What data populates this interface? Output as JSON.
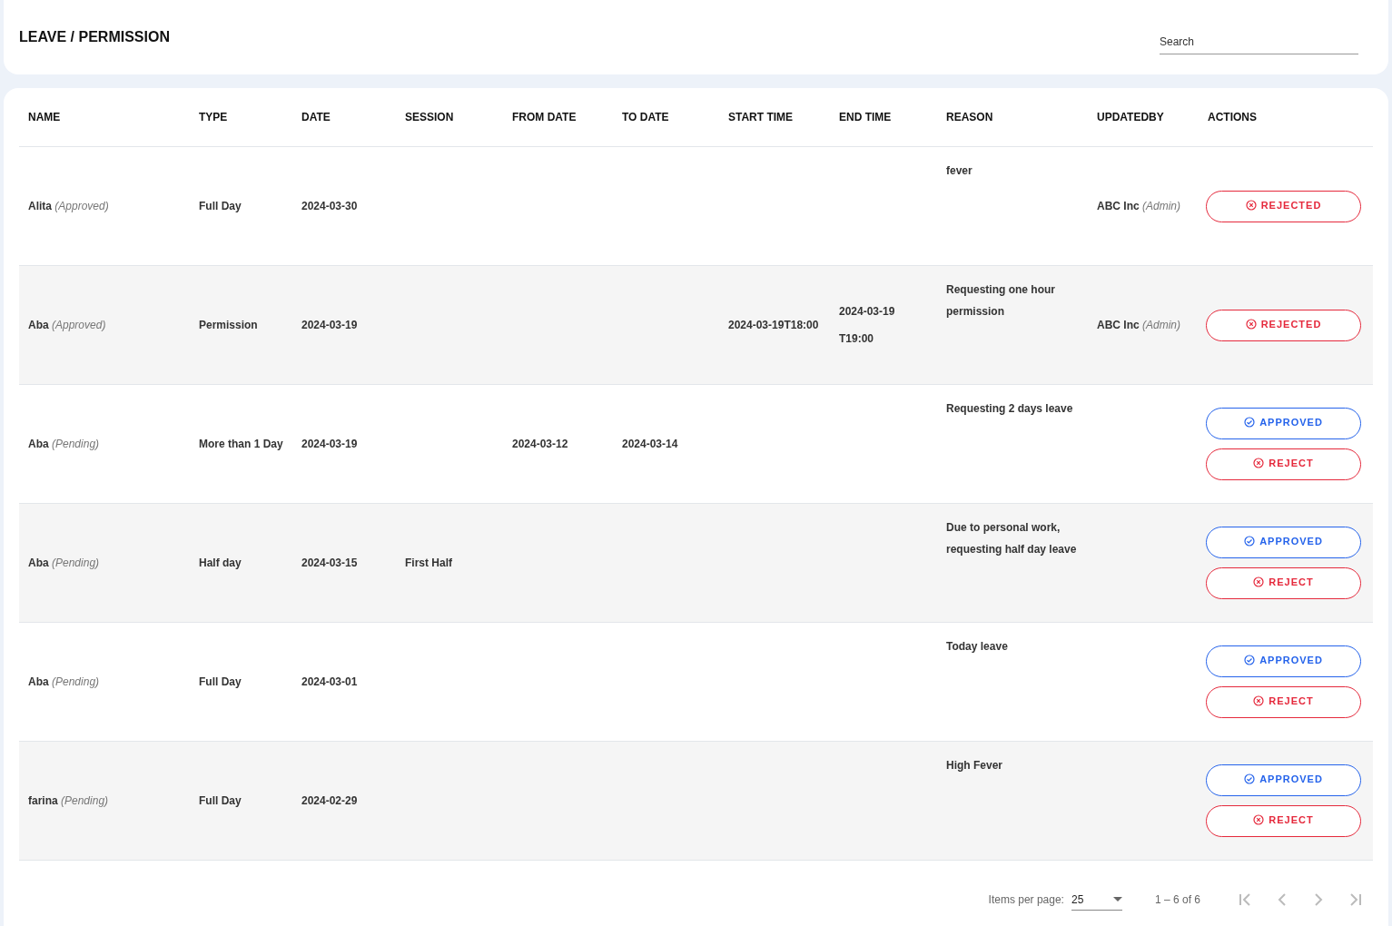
{
  "header": {
    "title": "LEAVE / PERMISSION",
    "search": {
      "placeholder": "Search"
    }
  },
  "table": {
    "columns": [
      "NAME",
      "TYPE",
      "DATE",
      "SESSION",
      "FROM DATE",
      "TO DATE",
      "START TIME",
      "END TIME",
      "REASON",
      "UPDATEDBY",
      "ACTIONS"
    ],
    "rows": [
      {
        "name": "Alita *(Approved)*",
        "type": "Full Day",
        "date": "2024-03-30",
        "session": "",
        "from_date": "",
        "to_date": "",
        "start_time": "",
        "end_time": "",
        "reason": "fever",
        "updated_by": "ABC Inc *(Admin)*",
        "actions": [
          {
            "kind": "reject",
            "label": "REJECTED"
          }
        ]
      },
      {
        "name": "Aba *(Approved)*",
        "type": "Permission",
        "date": "2024-03-19",
        "session": "",
        "from_date": "",
        "to_date": "",
        "start_time": "2024-03-19T18:00",
        "end_time": "2024-03-19T19:00",
        "reason": "Requesting one hour permission",
        "updated_by": "ABC Inc *(Admin)*",
        "actions": [
          {
            "kind": "reject",
            "label": "REJECTED"
          }
        ]
      },
      {
        "name": "Aba *(Pending)*",
        "type": "More than 1 Day",
        "date": "2024-03-19",
        "session": "",
        "from_date": "2024-03-12",
        "to_date": "2024-03-14",
        "start_time": "",
        "end_time": "",
        "reason": "Requesting 2 days leave",
        "updated_by": "",
        "actions": [
          {
            "kind": "approve",
            "label": "APPROVED"
          },
          {
            "kind": "reject",
            "label": "REJECT"
          }
        ]
      },
      {
        "name": "Aba *(Pending)*",
        "type": "Half day",
        "date": "2024-03-15",
        "session": "First Half",
        "from_date": "",
        "to_date": "",
        "start_time": "",
        "end_time": "",
        "reason": "Due to personal work, requesting half day leave",
        "updated_by": "",
        "actions": [
          {
            "kind": "approve",
            "label": "APPROVED"
          },
          {
            "kind": "reject",
            "label": "REJECT"
          }
        ]
      },
      {
        "name": "Aba *(Pending)*",
        "type": "Full Day",
        "date": "2024-03-01",
        "session": "",
        "from_date": "",
        "to_date": "",
        "start_time": "",
        "end_time": "",
        "reason": "Today leave",
        "updated_by": "",
        "actions": [
          {
            "kind": "approve",
            "label": "APPROVED"
          },
          {
            "kind": "reject",
            "label": "REJECT"
          }
        ]
      },
      {
        "name": "farina *(Pending)*",
        "type": "Full Day",
        "date": "2024-02-29",
        "session": "",
        "from_date": "",
        "to_date": "",
        "start_time": "",
        "end_time": "",
        "reason": "High Fever",
        "updated_by": "",
        "actions": [
          {
            "kind": "approve",
            "label": "APPROVED"
          },
          {
            "kind": "reject",
            "label": "REJECT"
          }
        ]
      }
    ]
  },
  "paginator": {
    "items_per_page_label": "Items per page:",
    "page_size": "25",
    "range": "1 – 6 of 6",
    "nav": [
      {
        "kind": "first",
        "disabled": true
      },
      {
        "kind": "prev",
        "disabled": true
      },
      {
        "kind": "next",
        "disabled": true
      },
      {
        "kind": "last",
        "disabled": true
      }
    ]
  }
}
